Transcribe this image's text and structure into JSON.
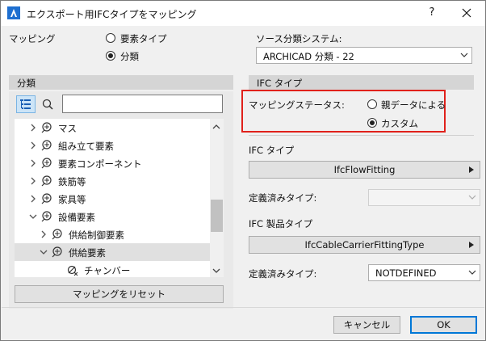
{
  "window": {
    "title": "エクスポート用IFCタイプをマッピング",
    "help_label": "?"
  },
  "mapping": {
    "label": "マッピング",
    "options": [
      {
        "label": "要素タイプ",
        "selected": false
      },
      {
        "label": "分類",
        "selected": true
      }
    ]
  },
  "source_system": {
    "label": "ソース分類システム:",
    "value": "ARCHICAD 分類 - 22"
  },
  "left_panel": {
    "header": "分類",
    "search": {
      "value": "",
      "placeholder": ""
    },
    "tree": [
      {
        "label": "マス",
        "expanded": false,
        "level": 0,
        "selected": false,
        "icon": "classification-icon"
      },
      {
        "label": "組み立て要素",
        "expanded": false,
        "level": 0,
        "selected": false,
        "icon": "classification-icon"
      },
      {
        "label": "要素コンポーネント",
        "expanded": false,
        "level": 0,
        "selected": false,
        "icon": "classification-icon"
      },
      {
        "label": "鉄筋等",
        "expanded": false,
        "level": 0,
        "selected": false,
        "icon": "classification-icon"
      },
      {
        "label": "家具等",
        "expanded": false,
        "level": 0,
        "selected": false,
        "icon": "classification-icon"
      },
      {
        "label": "設備要素",
        "expanded": true,
        "level": 0,
        "selected": false,
        "icon": "classification-icon"
      },
      {
        "label": "供給制御要素",
        "expanded": false,
        "level": 1,
        "selected": false,
        "icon": "classification-icon"
      },
      {
        "label": "供給要素",
        "expanded": true,
        "level": 1,
        "selected": true,
        "icon": "classification-icon"
      },
      {
        "label": "チャンバー",
        "expanded": false,
        "level": 2,
        "selected": false,
        "icon": "unmapped-classification-icon"
      }
    ],
    "reset_button": "マッピングをリセット"
  },
  "right_panel": {
    "header": "IFC タイプ",
    "mapping_status": {
      "label": "マッピングステータス:",
      "options": [
        {
          "label": "親データによる",
          "selected": false
        },
        {
          "label": "カスタム",
          "selected": true
        }
      ]
    },
    "ifc_type": {
      "label": "IFC タイプ",
      "value": "IfcFlowFitting"
    },
    "predefined_type_1": {
      "label": "定義済みタイプ:",
      "value": ""
    },
    "ifc_product_type": {
      "label": "IFC 製品タイプ",
      "value": "IfcCableCarrierFittingType"
    },
    "predefined_type_2": {
      "label": "定義済みタイプ:",
      "value": "NOTDEFINED"
    }
  },
  "footer": {
    "cancel": "キャンセル",
    "ok": "OK"
  },
  "colors": {
    "highlight": "#e0211b",
    "accent": "#0078d7",
    "selection": "#e0e0e0"
  }
}
